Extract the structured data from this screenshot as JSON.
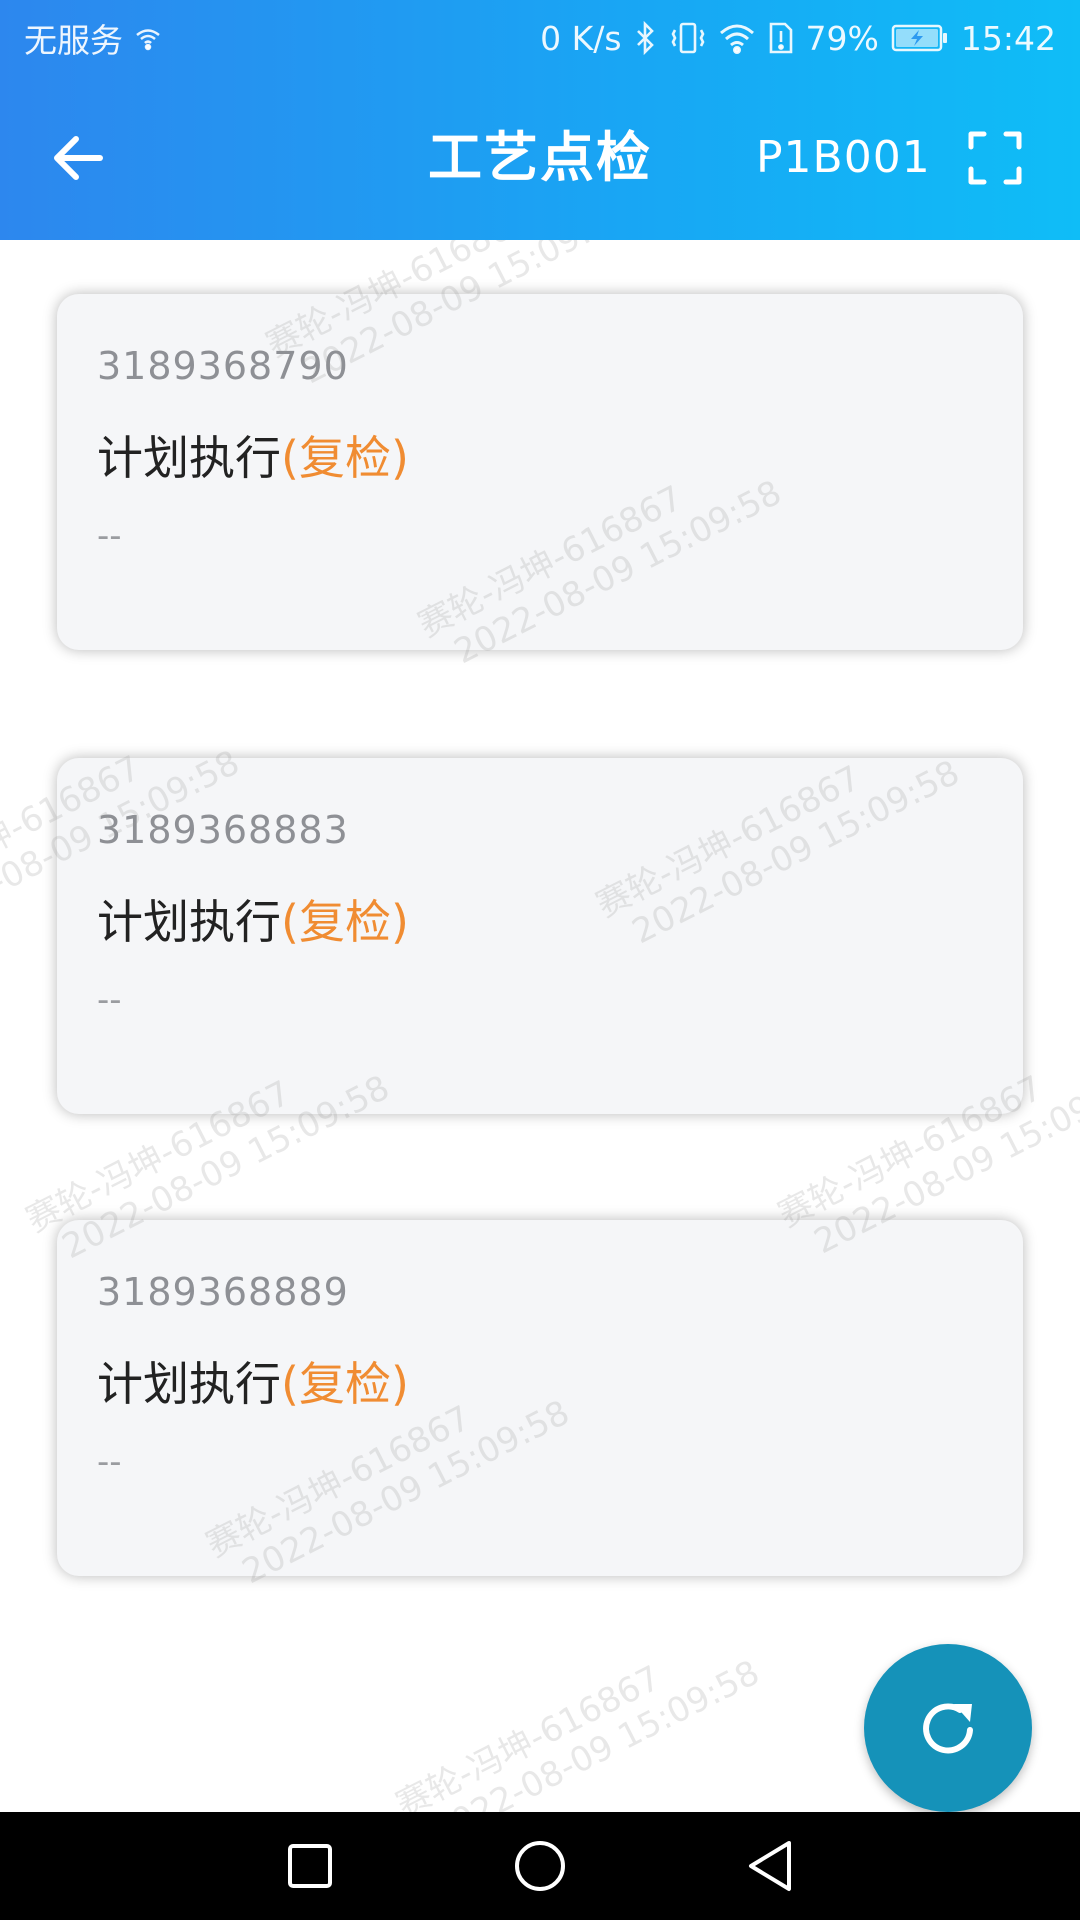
{
  "status_bar": {
    "carrier": "无服务",
    "net_speed": "0 K/s",
    "battery_pct": "79%",
    "time": "15:42"
  },
  "header": {
    "title": "工艺点检",
    "device_code": "P1B001"
  },
  "cards": [
    {
      "id": "3189368790",
      "title": "计划执行",
      "status": "(复检)",
      "note": "--"
    },
    {
      "id": "3189368883",
      "title": "计划执行",
      "status": "(复检)",
      "note": "--"
    },
    {
      "id": "3189368889",
      "title": "计划执行",
      "status": "(复检)",
      "note": "--"
    }
  ],
  "watermark": {
    "line1": "赛轮-冯坤-616867",
    "line2": "2022-08-09 15:09:58"
  },
  "icons": {
    "back": "arrow-left-icon",
    "scan": "scan-frame-icon",
    "refresh": "refresh-icon"
  },
  "colors": {
    "header_start": "#2d87ee",
    "header_end": "#0fbdf7",
    "status_accent": "#f08c32",
    "fab": "#1592b9"
  }
}
